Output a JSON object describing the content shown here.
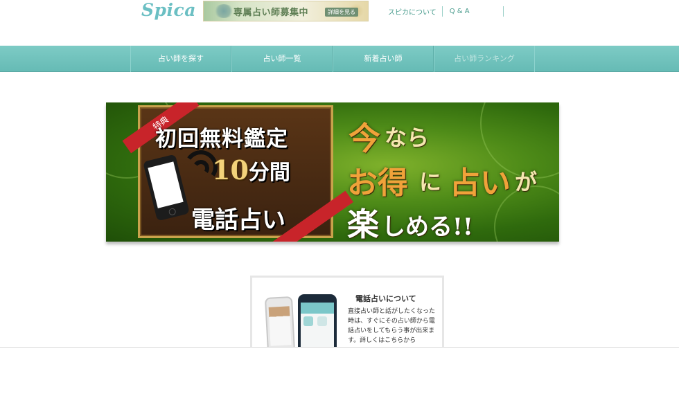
{
  "header": {
    "logo": "Spica",
    "banner_text": "専属占い師募集中",
    "banner_button": "詳細を見る",
    "links": [
      "スピカについて",
      "Q & A"
    ]
  },
  "nav": {
    "items": [
      "占い師を探す",
      "占い師一覧",
      "新着占い師",
      "占い師ランキング"
    ]
  },
  "promo": {
    "badge": "特典",
    "title": "初回無料鑑定",
    "minutes": "10",
    "minutes_unit": "分間",
    "subtitle": "電話占い",
    "slogan_1a": "今",
    "slogan_1b": "なら",
    "slogan_2a": "お得",
    "slogan_2b": "に",
    "slogan_2c": "占い",
    "slogan_2d": "が",
    "slogan_3a": "楽",
    "slogan_3b": "しめる!!"
  },
  "info_card": {
    "title": "電話占いについて",
    "text": "直接占い師と話がしたくなった時は、すぐにその占い師から電話占いをしてもらう事が出来ます。詳しくはこちらから"
  },
  "colors": {
    "accent": "#6bbfc3",
    "nav_bg": "#66bbb5",
    "promo_red": "#c8242a",
    "promo_gold": "#f0a23a"
  }
}
